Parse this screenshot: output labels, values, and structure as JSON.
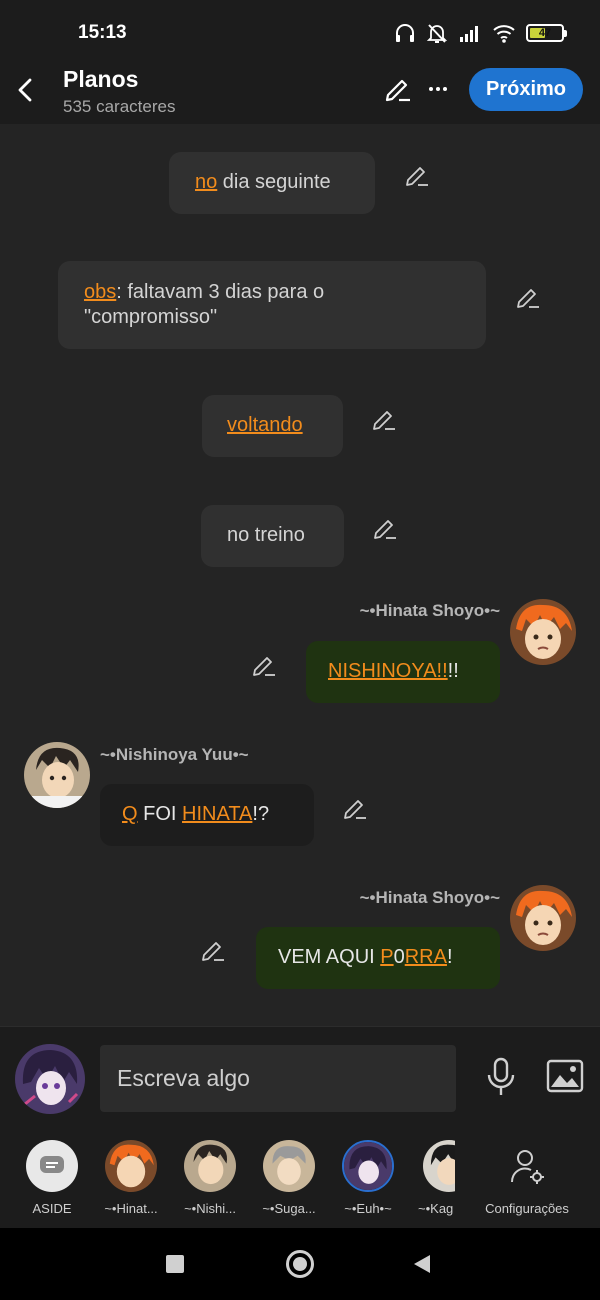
{
  "status_bar": {
    "time": "15:13",
    "battery": "47",
    "battery_level_percent": 47
  },
  "header": {
    "title": "Planos",
    "subtitle": "535 caracteres",
    "next_label": "Próximo"
  },
  "messages": {
    "m1": {
      "link": "no",
      "rest": " dia seguinte"
    },
    "m2": {
      "link": "obs",
      "rest": ": faltavam 3 dias para o \"compromisso\""
    },
    "m3": {
      "link": "voltando"
    },
    "m4": {
      "text": "no treino"
    },
    "m5": {
      "author": "~•Hinata Shoyo•~",
      "link": "NISHINOYA!!",
      "rest": "!!"
    },
    "m6": {
      "author": "~•Nishinoya Yuu•~",
      "link1": "Q",
      "mid": " FOI ",
      "link2": "HINATA",
      "end": "!?"
    },
    "m7": {
      "author": "~•Hinata Shoyo•~",
      "start": "VEM AQUI ",
      "link1": "P",
      "mid": "0",
      "link2": "RRA",
      "end": "!"
    }
  },
  "composer": {
    "placeholder": "Escreva algo"
  },
  "characters": [
    {
      "label": "ASIDE"
    },
    {
      "label": "~•Hinat..."
    },
    {
      "label": "~•Nishi..."
    },
    {
      "label": "~•Suga..."
    },
    {
      "label": "~•Euh•~"
    },
    {
      "label": "~•Kag"
    },
    {
      "label": "Configurações"
    }
  ],
  "colors": {
    "accent": "#1f74d0",
    "link": "#f28c1c",
    "bubble_green": "#1f3311"
  },
  "icons": [
    "back-icon",
    "pencil-icon",
    "more-icon",
    "mic-icon",
    "image-icon",
    "settings-icon"
  ]
}
